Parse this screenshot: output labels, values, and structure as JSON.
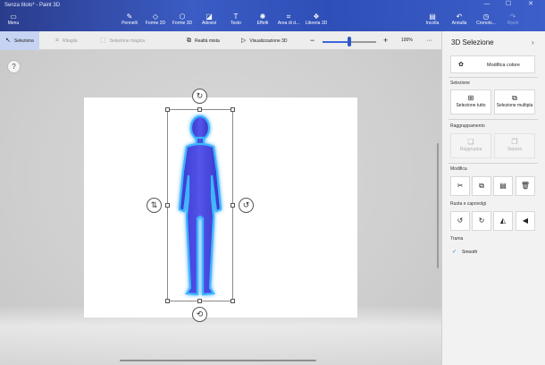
{
  "window": {
    "title": "Senza titolo* - Paint 3D",
    "minimize": "—",
    "maximize": "☐",
    "close": "✕"
  },
  "ribbon": {
    "menu_label": "Menu",
    "tools": [
      {
        "label": "Pennelli",
        "icon": "brush-icon"
      },
      {
        "label": "Forme 2D",
        "icon": "shapes-2d-icon"
      },
      {
        "label": "Forme 3D",
        "icon": "cube-icon"
      },
      {
        "label": "Adesivi",
        "icon": "sticker-icon"
      },
      {
        "label": "Testo",
        "icon": "text-icon"
      },
      {
        "label": "Effetti",
        "icon": "effects-icon"
      },
      {
        "label": "Area di d...",
        "icon": "canvas-icon"
      },
      {
        "label": "Libreria 3D",
        "icon": "library-3d-icon"
      }
    ],
    "right_tools": [
      {
        "label": "Incolla",
        "icon": "paste-icon",
        "enabled": true
      },
      {
        "label": "Annulla",
        "icon": "undo-icon",
        "enabled": true
      },
      {
        "label": "Cronolo...",
        "icon": "history-icon",
        "enabled": true
      },
      {
        "label": "Ripeti",
        "icon": "redo-icon",
        "enabled": false
      }
    ]
  },
  "toolstrip": {
    "seleziona": "Seleziona",
    "ritaglia": "Ritaglia",
    "selezione_magica": "Selezione magica",
    "realta_mista": "Realtà mista",
    "visualizzazione_3d": "Visualizzazione 3D",
    "zoom_minus": "−",
    "zoom_plus": "+",
    "zoom_level": "100%",
    "more": "···",
    "zoom_fraction": 0.5
  },
  "canvas": {
    "help": "?"
  },
  "panel": {
    "title": "3D Selezione",
    "close": "›",
    "modifica_colore": "Modifica colore",
    "selezione_head": "Selezione",
    "seleziona_tutto": "Selezione tutto",
    "selezione_multipla": "Selezione multipla",
    "raggruppamento_head": "Raggruppamento",
    "raggruppa": "Raggruppa",
    "separa": "Separa",
    "modifica_head": "Modifica",
    "ruota_head": "Ruota e capovolgi",
    "trama_head": "Trama",
    "smooth": "Smooth"
  },
  "colors": {
    "ribbon": "#2e4fb7",
    "figure": "#4747e0",
    "glow": "#3bb6ff",
    "accent": "#1f7fd6"
  }
}
